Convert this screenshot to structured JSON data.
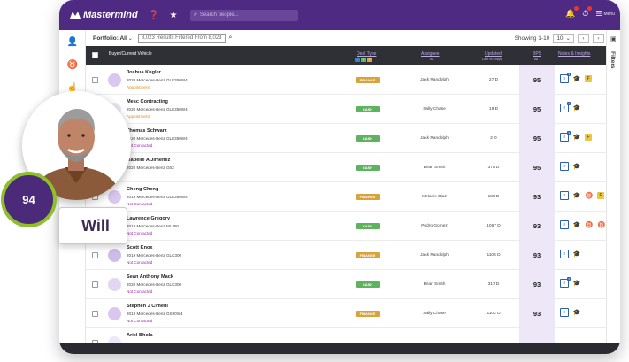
{
  "app": {
    "brand": "Mastermind",
    "search_placeholder": "Search people...",
    "notif_count_1": "27",
    "notif_count_2": "5",
    "menu_label": "Menu",
    "colors": {
      "brand_purple": "#4f2a83",
      "header_dark": "#2f3036",
      "finance": "#d9a23a",
      "cash": "#5fb35f",
      "bps_highlight": "#ede7f8",
      "accent_green": "#8fbf2a"
    }
  },
  "toolbar": {
    "portfolio_label": "Portfolio:",
    "portfolio_value": "All",
    "results_text": "8,023 Results Filtered From 8,023",
    "showing_text": "Showing 1-10",
    "per_page": "10",
    "filters_label": "Filters"
  },
  "table": {
    "headers": {
      "buyer": "Buyer/Current Vehicle",
      "deal_type": "Deal Type",
      "assignee": "Assignee",
      "updated": "Updated",
      "bps": "BPS",
      "notes": "Notes & Insights"
    },
    "header_sub": {
      "assignee": "All",
      "updated": "Last 90 Days",
      "bps": "All"
    },
    "deal_tags": [
      "L",
      "C",
      "F"
    ],
    "rows": [
      {
        "name": "Joshua Kugler",
        "vehicle": "2020 Mercedes-Benz GLE350W4",
        "status": "Appointment",
        "status_color": "#d98a1c",
        "deal": "FINANCE",
        "assignee": "Jack Randolph",
        "updated": "27 D",
        "bps": "95",
        "icons": [
          "doc",
          "cap",
          "fx"
        ],
        "doc_count": "3"
      },
      {
        "name": "Mesc Contracting",
        "vehicle": "2020 Mercedes-Benz GLE350W4",
        "status": "Appointment",
        "status_color": "#d98a1c",
        "deal": "CASH",
        "assignee": "Sally Chase",
        "updated": "19 D",
        "bps": "95",
        "icons": [
          "doc",
          "cap"
        ],
        "doc_count": "3"
      },
      {
        "name": "Thomas Schwarz",
        "vehicle": "2020 Mercedes-Benz GLE350W4",
        "status": "Not Contacted",
        "status_color": "#9b2bb3",
        "deal": "CASH",
        "assignee": "Jack Randolph",
        "updated": "2 D",
        "bps": "95",
        "icons": [
          "doc",
          "cap",
          "fx"
        ],
        "doc_count": "3"
      },
      {
        "name": "Isabelle A Jimenez",
        "vehicle": "2020 Mercedes-Benz G63",
        "status": "",
        "status_color": "#9b2bb3",
        "deal": "CASH",
        "assignee": "Brian Smith",
        "updated": "375 D",
        "bps": "95",
        "icons": [
          "doc",
          "cap"
        ],
        "doc_count": ""
      },
      {
        "name": "Cheng Cheng",
        "vehicle": "2019 Mercedes-Benz GLE350W4",
        "status": "Not Contacted",
        "status_color": "#9b2bb3",
        "deal": "FINANCE",
        "assignee": "Melanie Diaz",
        "updated": "189 D",
        "bps": "93",
        "icons": [
          "doc",
          "cap",
          "bull",
          "fx"
        ],
        "doc_count": ""
      },
      {
        "name": "Lawrence Gregory",
        "vehicle": "2019 Mercedes-Benz ML350",
        "status": "Not Contacted",
        "status_color": "#9b2bb3",
        "deal": "CASH",
        "assignee": "Pedro Gomez",
        "updated": "1067 D",
        "bps": "93",
        "icons": [
          "doc",
          "cap",
          "bull",
          "bull"
        ],
        "doc_count": ""
      },
      {
        "name": "Scott Knox",
        "vehicle": "2019 Mercedes-Benz GLC300",
        "status": "Not Contacted",
        "status_color": "#9b2bb3",
        "deal": "FINANCE",
        "assignee": "Jack Randolph",
        "updated": "1105 D",
        "bps": "93",
        "icons": [
          "doc",
          "cap"
        ],
        "doc_count": ""
      },
      {
        "name": "Sean Anthony Mack",
        "vehicle": "2020 Mercedes-Benz GLC300",
        "status": "Not Contacted",
        "status_color": "#9b2bb3",
        "deal": "CASH",
        "assignee": "Brian Smith",
        "updated": "317 D",
        "bps": "93",
        "icons": [
          "doc",
          "cap"
        ],
        "doc_count": "3"
      },
      {
        "name": "Stephen J Cimeni",
        "vehicle": "2019 Mercedes-Benz GS90W4",
        "status": "Not Contacted",
        "status_color": "#9b2bb3",
        "deal": "FINANCE",
        "assignee": "Sally Chase",
        "updated": "1102 D",
        "bps": "93",
        "icons": [
          "doc",
          "cap"
        ],
        "doc_count": ""
      },
      {
        "name": "Ariel Bhola",
        "vehicle": "",
        "status": "",
        "status_color": "#9b2bb3",
        "deal": "",
        "assignee": "",
        "updated": "",
        "bps": "",
        "icons": [],
        "doc_count": ""
      }
    ]
  },
  "overlay": {
    "score": "94",
    "name": "Will"
  }
}
